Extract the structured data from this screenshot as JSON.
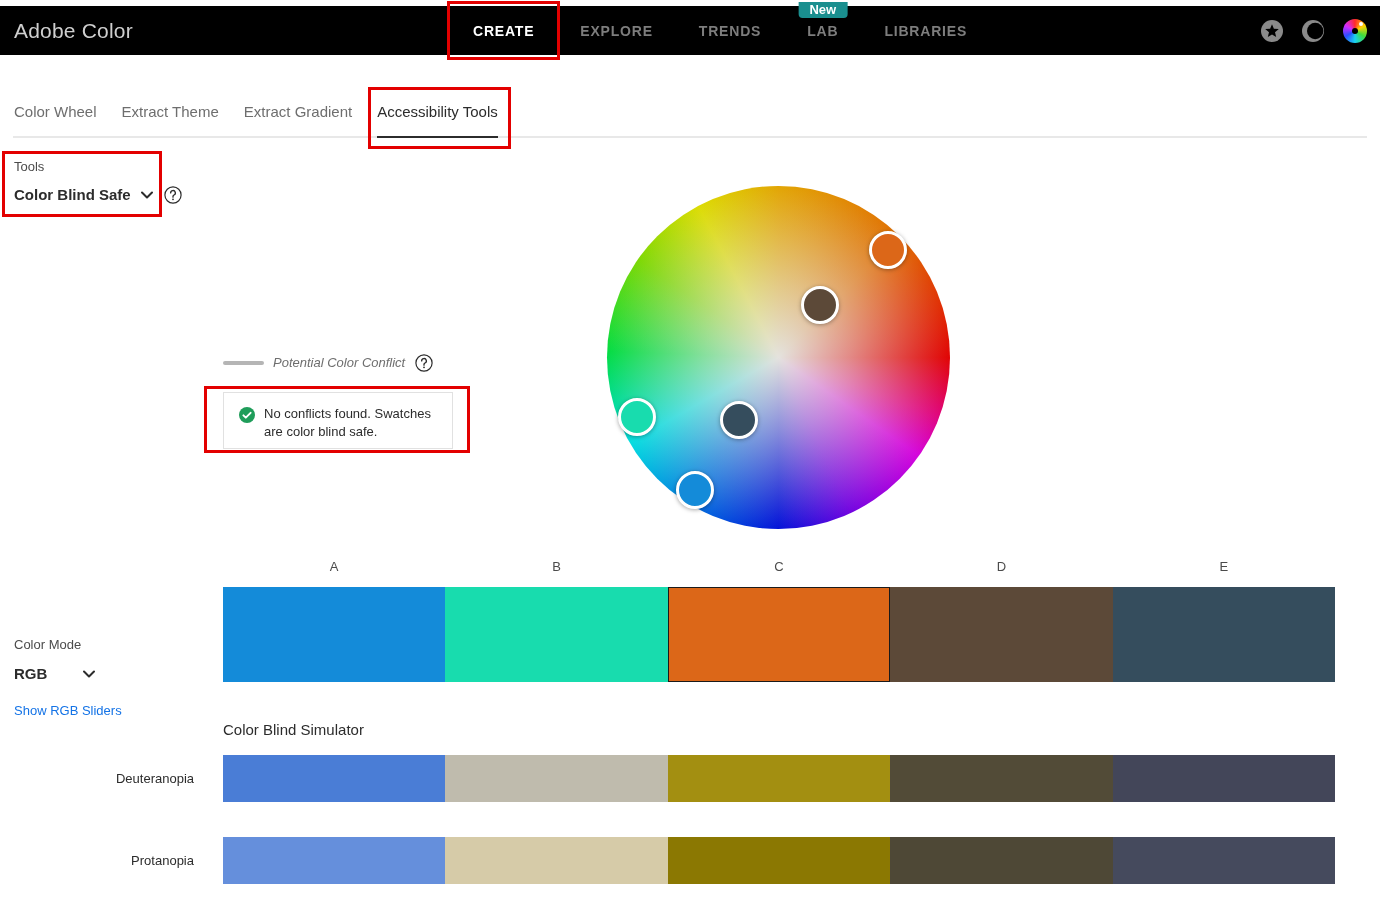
{
  "header": {
    "logo": "Adobe Color",
    "nav": [
      {
        "label": "CREATE",
        "selected": true,
        "highlighted": true
      },
      {
        "label": "EXPLORE",
        "selected": false,
        "highlighted": false
      },
      {
        "label": "TRENDS",
        "selected": false,
        "highlighted": false
      },
      {
        "label": "LAB",
        "selected": false,
        "highlighted": false,
        "badge": "New"
      },
      {
        "label": "LIBRARIES",
        "selected": false,
        "highlighted": false
      }
    ]
  },
  "tabs": [
    {
      "label": "Color Wheel",
      "selected": false,
      "highlighted": false
    },
    {
      "label": "Extract Theme",
      "selected": false,
      "highlighted": false
    },
    {
      "label": "Extract Gradient",
      "selected": false,
      "highlighted": false
    },
    {
      "label": "Accessibility Tools",
      "selected": true,
      "highlighted": true
    }
  ],
  "tools": {
    "label": "Tools",
    "value": "Color Blind Safe",
    "highlighted": true
  },
  "legend": {
    "label": "Potential Color Conflict"
  },
  "result": {
    "message": "No conflicts found. Swatches are color blind safe.",
    "highlighted": true
  },
  "color_mode": {
    "label": "Color Mode",
    "value": "RGB",
    "link": "Show RGB Sliders"
  },
  "swatches": [
    {
      "label": "A",
      "color": "#148bd9",
      "selected": false
    },
    {
      "label": "B",
      "color": "#18dcae",
      "selected": false
    },
    {
      "label": "C",
      "color": "#dc6718",
      "selected": true
    },
    {
      "label": "D",
      "color": "#5c4938",
      "selected": false
    },
    {
      "label": "E",
      "color": "#354d5d",
      "selected": false
    }
  ],
  "simulator": {
    "title": "Color Blind Simulator",
    "rows": [
      {
        "name": "Deuteranopia",
        "swatches": [
          {
            "color": "#4a7dd6"
          },
          {
            "color": "#bfbbad"
          },
          {
            "color": "#a38f11"
          },
          {
            "color": "#524b37"
          },
          {
            "color": "#434659"
          }
        ]
      },
      {
        "name": "Protanopia",
        "swatches": [
          {
            "color": "#658fdc"
          },
          {
            "color": "#d6cba8"
          },
          {
            "color": "#8b7802"
          },
          {
            "color": "#4e4836"
          },
          {
            "color": "#454a5d"
          }
        ]
      }
    ]
  }
}
